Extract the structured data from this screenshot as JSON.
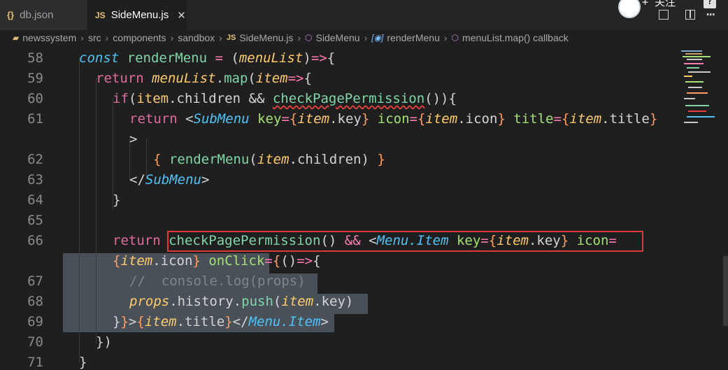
{
  "tabs": [
    {
      "icon": "{}",
      "label": "db.json"
    },
    {
      "icon": "JS",
      "label": "SideMenu.js",
      "close": "✕"
    }
  ],
  "topright": {
    "follow": "+ 关注",
    "help": "?"
  },
  "breadcrumb": [
    "newssystem",
    "src",
    "components",
    "sandbox",
    "SideMenu.js",
    "SideMenu",
    "renderMenu",
    "menuList.map() callback"
  ],
  "line_numbers": [
    "58",
    "59",
    "60",
    "61",
    "62",
    "63",
    "64",
    "65",
    "66",
    "67",
    "68",
    "69",
    "70",
    "71"
  ]
}
